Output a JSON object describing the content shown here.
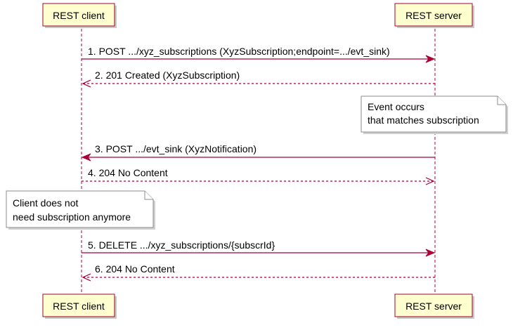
{
  "participants": {
    "client_label": "REST client",
    "server_label": "REST server"
  },
  "messages": [
    {
      "label": "1. POST .../xyz_subscriptions (XyzSubscription;endpoint=.../evt_sink)",
      "direction": "client-to-server",
      "style": "solid"
    },
    {
      "label": "2. 201 Created (XyzSubscription)",
      "direction": "server-to-client",
      "style": "dashed"
    },
    {
      "label": "3. POST .../evt_sink (XyzNotification)",
      "direction": "server-to-client",
      "style": "solid"
    },
    {
      "label": "4. 204 No Content",
      "direction": "client-to-server",
      "style": "dashed"
    },
    {
      "label": "5. DELETE .../xyz_subscriptions/{subscrId}",
      "direction": "client-to-server",
      "style": "solid"
    },
    {
      "label": "6. 204 No Content",
      "direction": "server-to-client",
      "style": "dashed"
    }
  ],
  "notes": {
    "server_note": {
      "line1": "Event occurs",
      "line2": "that matches subscription"
    },
    "client_note": {
      "line1": "Client does not",
      "line2": "need subscription anymore"
    }
  },
  "colors": {
    "line": "#a80036",
    "box_fill": "#fefece",
    "note_fill": "#ffffff"
  }
}
